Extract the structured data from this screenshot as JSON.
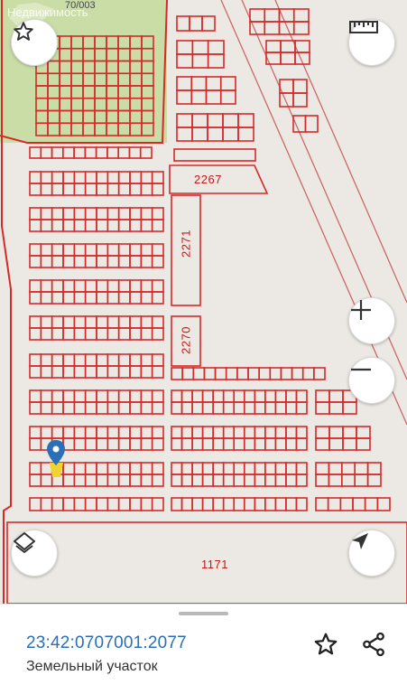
{
  "map": {
    "watermark": "Недвижимость",
    "top_cadastral_fragment": "70/003",
    "parcel_labels": {
      "p2267": "2267",
      "p2271": "2271",
      "p2270": "2270",
      "p1171": "1171"
    },
    "buttons": {
      "favorite": "star-outline-icon",
      "ruler": "ruler-icon",
      "zoom_in": "+",
      "zoom_out": "−",
      "layers": "layers-icon",
      "locate": "navigation-arrow-icon"
    },
    "colors": {
      "background": "#ece8e3",
      "parcel_stroke": "#d42a2a",
      "garden_fill": "#c8dca0",
      "marker": "#2a6fb8",
      "marker_base": "#f2d22e"
    }
  },
  "sheet": {
    "cadastral_number": "23:42:0707001:2077",
    "parcel_type": "Земельный участок",
    "actions": {
      "favorite": "star-outline-icon",
      "share": "share-icon"
    }
  }
}
